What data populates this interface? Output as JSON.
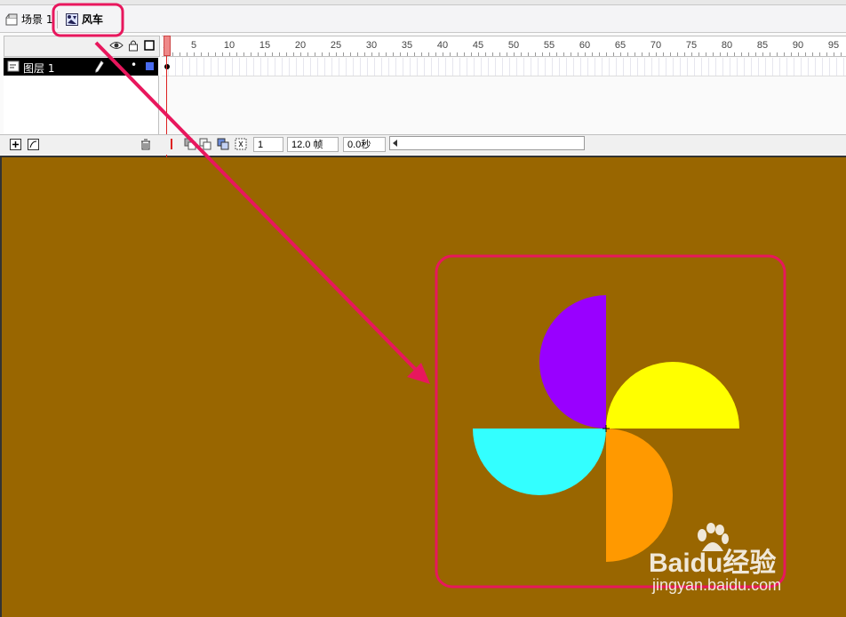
{
  "breadcrumb": {
    "scene_label": "场景 1",
    "symbol_label": "风车"
  },
  "timeline": {
    "ruler_ticks": [
      "1",
      "5",
      "10",
      "15",
      "20",
      "25",
      "30",
      "35",
      "40",
      "45",
      "50",
      "55",
      "60",
      "65",
      "70",
      "75",
      "80",
      "85",
      "90",
      "95"
    ],
    "layer": {
      "name": "图层 1"
    },
    "current_frame": "1",
    "frame_rate": "12.0 帧",
    "elapsed_time": "0.0秒"
  },
  "stage": {
    "background_color": "#996600",
    "pinwheel_colors": {
      "top": "#9900ff",
      "right": "#ffff00",
      "left": "#33ffff",
      "bottom": "#ff9900"
    }
  },
  "annotation_color": "#e8175d",
  "watermark": {
    "brand": "Baidu经验",
    "url": "jingyan.baidu.com"
  }
}
